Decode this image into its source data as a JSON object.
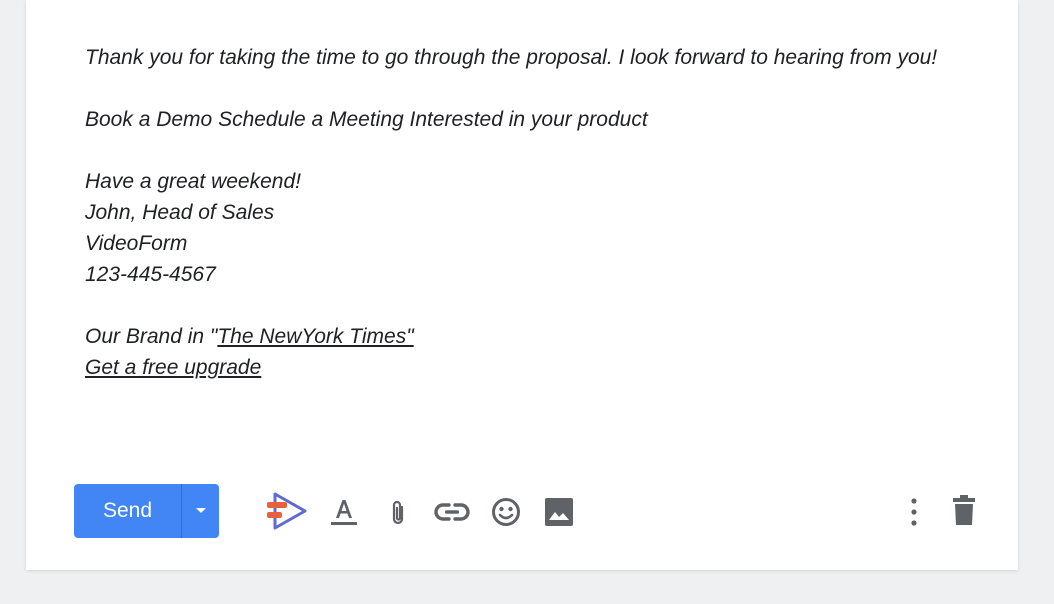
{
  "email": {
    "closing_line": "Thank you for taking the time to go through the proposal. I look forward to hearing from you!",
    "cta_line": "Book a Demo Schedule a Meeting Interested in your product",
    "greeting": "Have a great weekend!",
    "signature_name": "John, Head of Sales",
    "signature_company": "VideoForm",
    "signature_phone": "123-445-4567",
    "brand_prefix": "Our Brand in \"",
    "brand_link": "The NewYork Times\"",
    "upgrade_link": "Get a free upgrade"
  },
  "toolbar": {
    "send_label": "Send",
    "colors": {
      "send": "#4285f4",
      "icon": "#5f6368",
      "addon_orange": "#e8603c",
      "addon_blue": "#5e6bcf"
    }
  }
}
